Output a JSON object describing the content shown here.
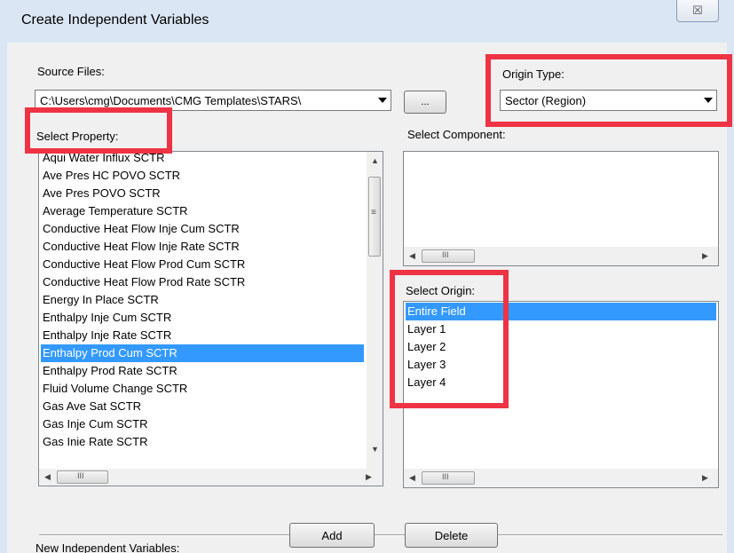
{
  "window": {
    "title": "Create Independent Variables",
    "close_glyph": "☒"
  },
  "source_files": {
    "label": "Source Files:",
    "value": "C:\\Users\\cmg\\Documents\\CMG Templates\\STARS\\",
    "browse_label": "..."
  },
  "origin_type": {
    "label": "Origin Type:",
    "value": "Sector (Region)"
  },
  "select_property": {
    "label": "Select Property:",
    "items": [
      "Aqui Water Influx SCTR",
      "Ave Pres HC POVO SCTR",
      "Ave Pres POVO SCTR",
      "Average Temperature SCTR",
      "Conductive Heat Flow Inje Cum SCTR",
      "Conductive Heat Flow Inje Rate SCTR",
      "Conductive Heat Flow Prod Cum SCTR",
      "Conductive Heat Flow Prod Rate SCTR",
      "Energy In Place SCTR",
      "Enthalpy Inje Cum SCTR",
      "Enthalpy Inje Rate SCTR",
      "Enthalpy Prod Cum SCTR",
      "Enthalpy Prod Rate SCTR",
      "Fluid Volume Change SCTR",
      "Gas Ave Sat SCTR",
      "Gas Inje Cum SCTR",
      "Gas Inje Rate SCTR"
    ],
    "selected": "Enthalpy Prod Cum SCTR"
  },
  "select_component": {
    "label": "Select Component:"
  },
  "select_origin": {
    "label": "Select Origin:",
    "items": [
      "Entire  Field",
      "Layer 1",
      "Layer 2",
      "Layer 3",
      "Layer 4"
    ],
    "selected": "Entire  Field"
  },
  "scroll_glyphs": {
    "up": "▲",
    "down": "▼",
    "left": "◀",
    "right": "▶",
    "grip": "III",
    "vgrip": "≡"
  },
  "buttons": {
    "add": "Add",
    "delete": "Delete"
  },
  "new_vars": {
    "label": "New Independent Variables:"
  },
  "annotation": {
    "color": "#ee3344"
  }
}
